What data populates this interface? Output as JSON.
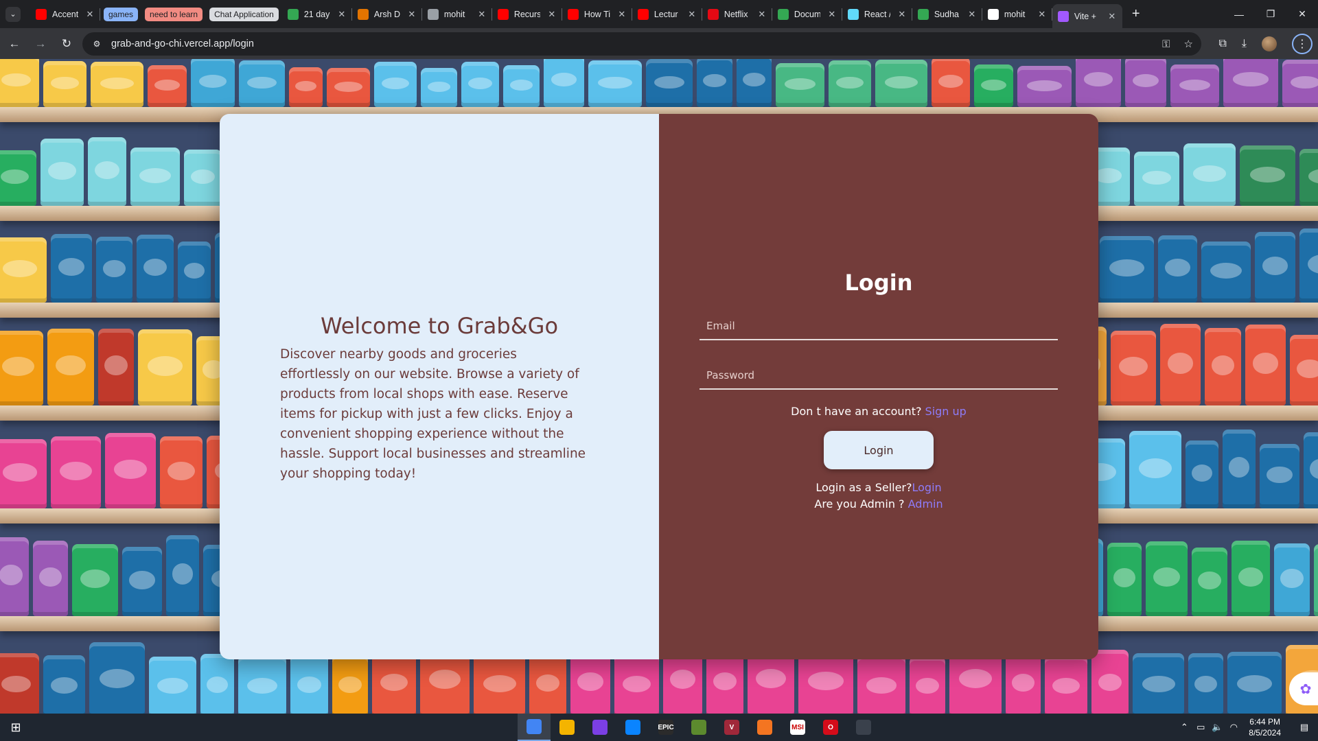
{
  "browser": {
    "tab_groups": [
      {
        "label": "games",
        "color": "#8ab4f8"
      },
      {
        "label": "need to learn",
        "color": "#f28b82"
      },
      {
        "label": "Chat Application",
        "color": "#dadce0"
      }
    ],
    "tabs": [
      {
        "label": "Accent",
        "icon": "youtube-icon",
        "color": "#ff0000"
      },
      {
        "label": "21 day",
        "icon": "drive-icon",
        "color": "#34a853"
      },
      {
        "label": "Arsh D",
        "icon": "arsh-icon",
        "color": "#e37400"
      },
      {
        "label": "mohit",
        "icon": "link-icon",
        "color": "#9aa0a6"
      },
      {
        "label": "Recurs",
        "icon": "youtube-icon",
        "color": "#ff0000"
      },
      {
        "label": "How Ti",
        "icon": "youtube-icon",
        "color": "#ff0000"
      },
      {
        "label": "Lectur",
        "icon": "youtube-icon",
        "color": "#ff0000"
      },
      {
        "label": "Netflix",
        "icon": "netflix-icon",
        "color": "#e50914"
      },
      {
        "label": "Docum",
        "icon": "drive-icon",
        "color": "#34a853"
      },
      {
        "label": "React /",
        "icon": "react-icon",
        "color": "#61dafb"
      },
      {
        "label": "Sudha",
        "icon": "drive-icon",
        "color": "#34a853"
      },
      {
        "label": "mohit",
        "icon": "github-icon",
        "color": "#ffffff"
      }
    ],
    "active_tab": {
      "label": "Vite +",
      "icon": "vite-icon",
      "color": "#a259ff"
    },
    "url": "grab-and-go-chi.vercel.app/login"
  },
  "page": {
    "welcome_title": "Welcome to Grab&Go",
    "welcome_text": "Discover nearby goods and groceries effortlessly on our website. Browse a variety of products from local shops with ease. Reserve items for pickup with just a few clicks. Enjoy a convenient shopping experience without the hassle. Support local businesses and streamline your shopping today!",
    "login_title": "Login",
    "email_placeholder": "Email",
    "password_placeholder": "Password",
    "signup_prompt": "Don t have an account? ",
    "signup_link": "Sign up",
    "login_button": "Login",
    "seller_prompt": "Login as a Seller?",
    "seller_link": "Login",
    "admin_prompt": "Are you Admin ? ",
    "admin_link": "Admin",
    "colors": {
      "left_panel": "#e2eefa",
      "right_panel": "#733c3a",
      "link": "#8e7cf8"
    }
  },
  "taskbar": {
    "apps": [
      {
        "name": "chrome-icon",
        "label": "",
        "color": "#4285f4",
        "running": true
      },
      {
        "name": "file-explorer-icon",
        "label": "",
        "color": "#f4b400",
        "running": false
      },
      {
        "name": "visual-studio-icon",
        "label": "",
        "color": "#7b3fe4",
        "running": false
      },
      {
        "name": "vscode-icon",
        "label": "",
        "color": "#0a84ff",
        "running": false
      },
      {
        "name": "epic-games-icon",
        "label": "EPIC",
        "color": "#2b2b2b",
        "running": false
      },
      {
        "name": "vite-icon",
        "label": "",
        "color": "#5c8a2e",
        "running": false
      },
      {
        "name": "valorant-icon",
        "label": "V",
        "color": "#a0283a",
        "running": false
      },
      {
        "name": "crunchyroll-icon",
        "label": "",
        "color": "#f47521",
        "running": false
      },
      {
        "name": "app-icon",
        "label": "MSI",
        "color": "#ffffff",
        "running": false
      },
      {
        "name": "opera-icon",
        "label": "O",
        "color": "#d50c1a",
        "running": false
      },
      {
        "name": "app-circle-icon",
        "label": "",
        "color": "#3a414c",
        "running": false
      }
    ],
    "time": "6:44 PM",
    "date": "8/5/2024"
  }
}
